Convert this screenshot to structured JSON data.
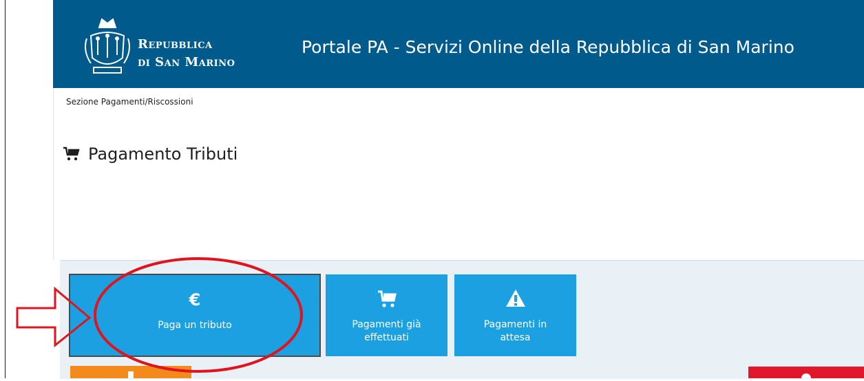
{
  "header": {
    "logo_line1": "Repubblica",
    "logo_line2": "di San Marino",
    "title": "Portale PA - Servizi Online della Repubblica di San Marino"
  },
  "breadcrumb": "Sezione Pagamenti/Riscossioni",
  "page": {
    "title": "Pagamento Tributi",
    "title_icon": "cart-icon"
  },
  "tiles": [
    {
      "label": "Paga un tributo",
      "icon": "euro-icon",
      "active": true
    },
    {
      "label_line1": "Pagamenti già",
      "label_line2": "effettuati",
      "icon": "cart-icon"
    },
    {
      "label_line1": "Pagamenti in",
      "label_line2": "attesa",
      "icon": "warning-icon"
    }
  ],
  "colors": {
    "header_bg": "#005a8c",
    "tile_bg": "#1ba1e2",
    "panel_bg": "#eaf1f6",
    "annotation": "#e0141e",
    "orange_tile": "#f38b1c",
    "red_tile": "#e0172a"
  }
}
